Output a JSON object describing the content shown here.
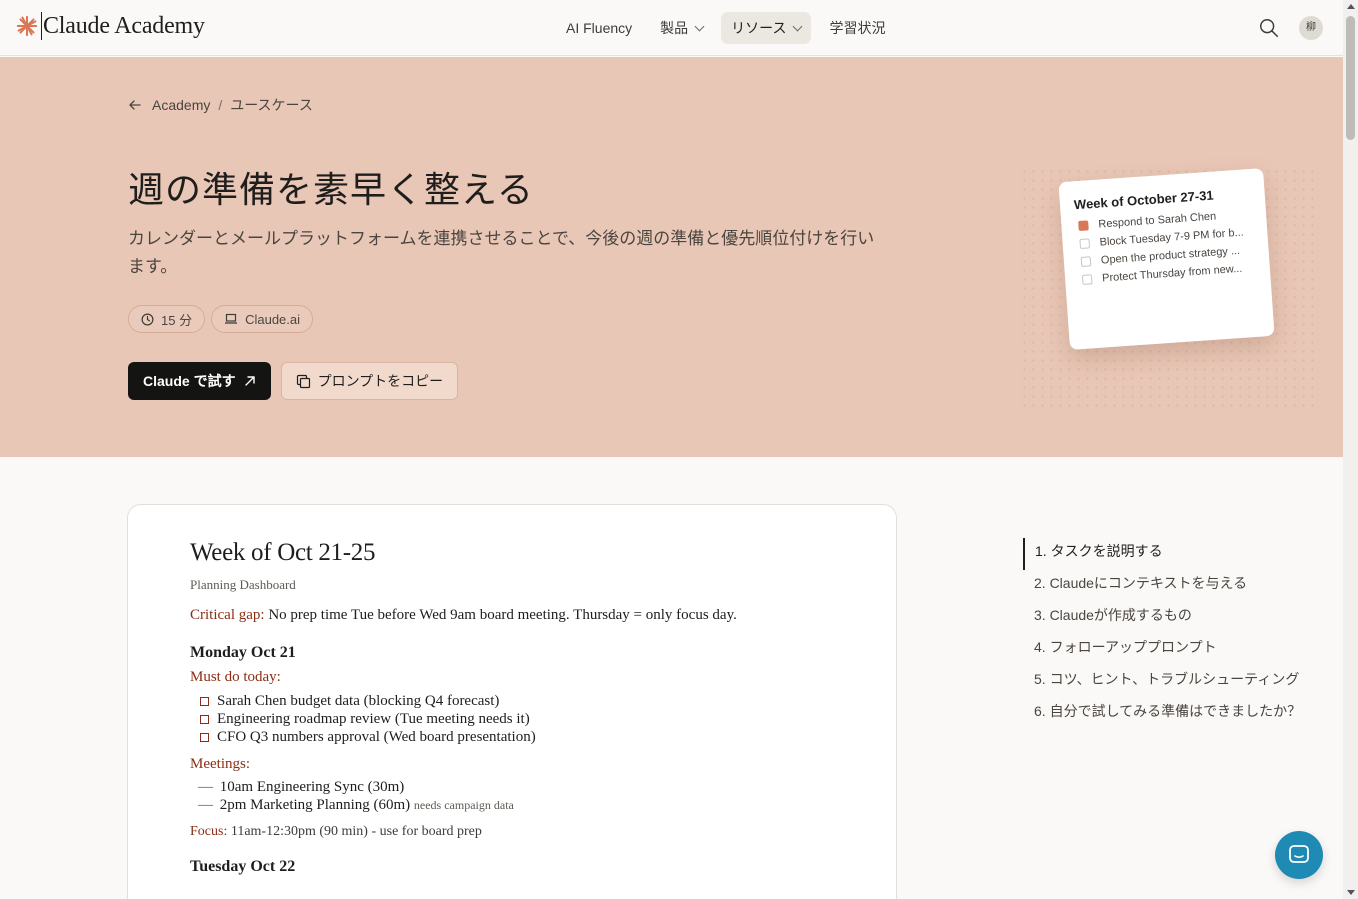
{
  "nav": {
    "logo_text": "Claude Academy",
    "items": [
      {
        "label": "AI Fluency",
        "has_dropdown": false,
        "active": false
      },
      {
        "label": "製品",
        "has_dropdown": true,
        "active": false
      },
      {
        "label": "リソース",
        "has_dropdown": true,
        "active": true
      },
      {
        "label": "学習状況",
        "has_dropdown": false,
        "active": false
      }
    ],
    "avatar_text": "柳",
    "icons": [
      "search-icon"
    ]
  },
  "hero": {
    "breadcrumb": {
      "root": "Academy",
      "separator": "/",
      "current": "ユースケース"
    },
    "title": "週の準備を素早く整える",
    "description": "カレンダーとメールプラットフォームを連携させることで、今後の週の準備と優先順位付けを行います。",
    "chips": {
      "duration": "15 分",
      "platform": "Claude.ai"
    },
    "primary_button": "Claude で試す",
    "secondary_button": "プロンプトをコピー",
    "background_color": "#e9c7b6",
    "preview_card": {
      "title": "Week of October 27-31",
      "items": [
        {
          "text": "Respond to Sarah Chen",
          "checked": true
        },
        {
          "text": "Block Tuesday 7-9 PM for b...",
          "checked": false
        },
        {
          "text": "Open the product strategy ...",
          "checked": false
        },
        {
          "text": "Protect Thursday from new...",
          "checked": false
        }
      ]
    }
  },
  "doc": {
    "title": "Week of Oct 21-25",
    "subtitle": "Planning Dashboard",
    "gap_label": "Critical gap:",
    "gap_text": "No prep time Tue before Wed 9am board meeting. Thursday = only focus day.",
    "monday": {
      "heading": "Monday Oct 21",
      "must_do_label": "Must do today:",
      "tasks": [
        "Sarah Chen budget data (blocking Q4 forecast)",
        "Engineering roadmap review (Tue meeting needs it)",
        "CFO Q3 numbers approval (Wed board presentation)"
      ],
      "meetings_label": "Meetings:",
      "meetings": [
        {
          "dash": "—",
          "text": "10am Engineering Sync (30m)",
          "note": ""
        },
        {
          "dash": "—",
          "text": "2pm Marketing Planning (60m)",
          "note": "needs campaign data"
        }
      ],
      "focus_label": "Focus:",
      "focus_text": "11am-12:30pm (90 min) - use for board prep"
    },
    "tuesday": {
      "heading": "Tuesday Oct 22"
    },
    "accent_color": "#8b2d14"
  },
  "toc": {
    "items": [
      "1. タスクを説明する",
      "2. Claudeにコンテキストを与える",
      "3. Claudeが作成するもの",
      "4. フォローアッププロンプト",
      "5. コツ、ヒント、トラブルシューティング",
      "6. 自分で試してみる準備はできましたか？"
    ],
    "active_index": 0
  },
  "chat": {
    "icon": "chat-icon",
    "color": "#1f8ab4"
  }
}
